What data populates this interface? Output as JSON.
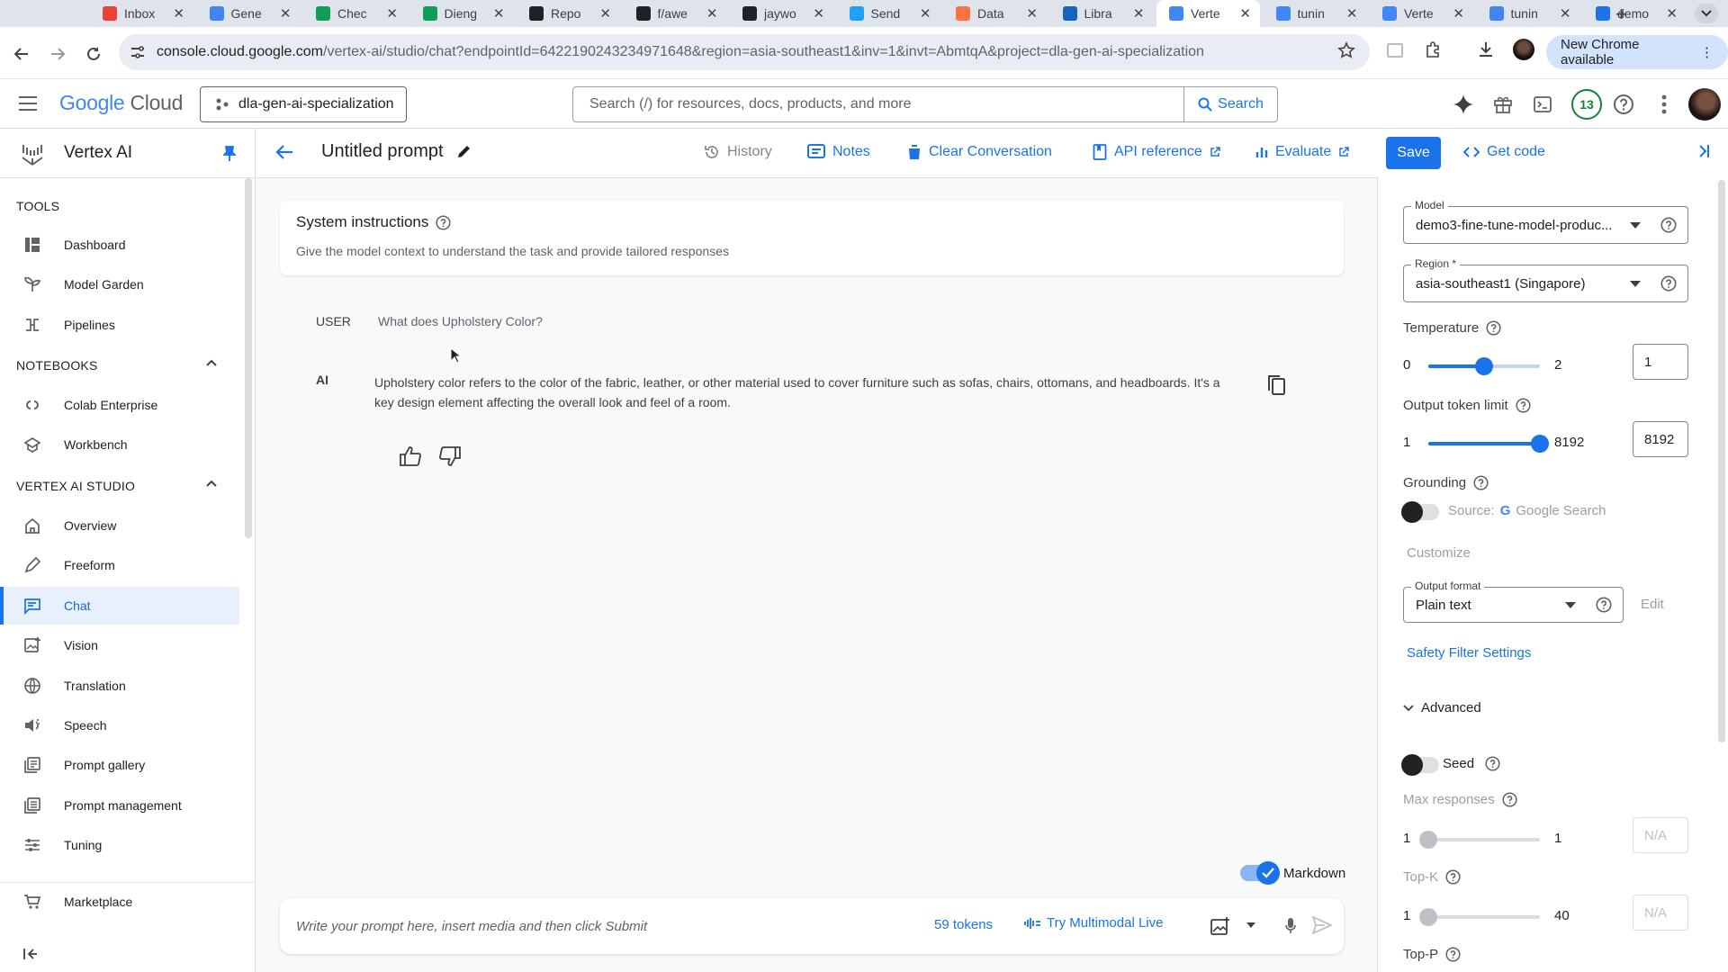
{
  "browser": {
    "tabs": [
      {
        "title": "Inbox",
        "color": "#ea4335"
      },
      {
        "title": "Gene",
        "color": "#4285f4"
      },
      {
        "title": "Chec",
        "color": "#0f9d58"
      },
      {
        "title": "Dieng",
        "color": "#0f9d58"
      },
      {
        "title": "Repo",
        "color": "#202124"
      },
      {
        "title": "f/awe",
        "color": "#202124"
      },
      {
        "title": "jaywo",
        "color": "#202124"
      },
      {
        "title": "Send",
        "color": "#1da1f2"
      },
      {
        "title": "Data",
        "color": "#ff7043"
      },
      {
        "title": "Libra",
        "color": "#1565c0"
      },
      {
        "title": "Verte",
        "color": "#4285f4"
      },
      {
        "title": "tunin",
        "color": "#4285f4"
      },
      {
        "title": "Verte",
        "color": "#4285f4"
      },
      {
        "title": "tunin",
        "color": "#4285f4"
      },
      {
        "title": "demo",
        "color": "#1a73e8"
      }
    ],
    "active_tab_index": 10,
    "url_host": "console.cloud.google.com",
    "url_path": "/vertex-ai/studio/chat?endpointId=6422190243234971648&region=asia-southeast1&inv=1&invt=AbmtqA&project=dla-gen-ai-specialization",
    "update_label": "New Chrome available"
  },
  "gcp": {
    "logo_google": "Google",
    "logo_cloud": "Cloud",
    "project": "dla-gen-ai-specialization",
    "search_placeholder": "Search (/) for resources, docs, products, and more",
    "search_button": "Search",
    "notification_count": "13"
  },
  "sidebar": {
    "title": "Vertex AI",
    "tools_header": "TOOLS",
    "tools": [
      {
        "label": "Dashboard",
        "icon": "dashboard-icon"
      },
      {
        "label": "Model Garden",
        "icon": "model-garden-icon"
      },
      {
        "label": "Pipelines",
        "icon": "pipelines-icon"
      }
    ],
    "notebooks_header": "NOTEBOOKS",
    "notebooks": [
      {
        "label": "Colab Enterprise",
        "icon": "colab-icon"
      },
      {
        "label": "Workbench",
        "icon": "workbench-icon"
      }
    ],
    "studio_header": "VERTEX AI STUDIO",
    "studio": [
      {
        "label": "Overview",
        "icon": "home-icon"
      },
      {
        "label": "Freeform",
        "icon": "freeform-icon"
      },
      {
        "label": "Chat",
        "icon": "chat-icon",
        "active": true
      },
      {
        "label": "Vision",
        "icon": "vision-icon"
      },
      {
        "label": "Translation",
        "icon": "translation-icon"
      },
      {
        "label": "Speech",
        "icon": "speech-icon"
      },
      {
        "label": "Prompt gallery",
        "icon": "prompt-gallery-icon"
      },
      {
        "label": "Prompt management",
        "icon": "prompt-management-icon"
      },
      {
        "label": "Tuning",
        "icon": "tuning-icon"
      }
    ],
    "marketplace": "Marketplace"
  },
  "main": {
    "title": "Untitled prompt",
    "actions": {
      "history": "History",
      "notes": "Notes",
      "clear": "Clear Conversation",
      "api": "API reference",
      "evaluate": "Evaluate"
    },
    "save": "Save",
    "get_code": "Get code",
    "system": {
      "heading": "System instructions",
      "description": "Give the model context to understand the task and provide tailored responses"
    },
    "conversation": {
      "user_role": "USER",
      "user_text": "What does Upholstery Color?",
      "ai_role": "AI",
      "ai_text": "Upholstery color refers to the color of the fabric, leather, or other material used to cover furniture such as sofas, chairs, ottomans, and headboards. It's a key design element affecting the overall look and feel of a room."
    },
    "markdown_label": "Markdown",
    "markdown_on": true,
    "composer_placeholder": "Write your prompt here, insert media and then click Submit",
    "tokens": "59 tokens",
    "try_live": "Try Multimodal Live"
  },
  "panel": {
    "model_label": "Model",
    "model_value": "demo3-fine-tune-model-produc...",
    "region_label": "Region *",
    "region_value": "asia-southeast1 (Singapore)",
    "temperature": {
      "label": "Temperature",
      "min": "0",
      "max": "2",
      "value": "1",
      "fraction": 0.5
    },
    "output_limit": {
      "label": "Output token limit",
      "min": "1",
      "max": "8192",
      "value": "8192",
      "fraction": 1.0
    },
    "grounding": {
      "label": "Grounding",
      "source": "Source:",
      "source_name": "Google Search",
      "customize": "Customize"
    },
    "output_format_label": "Output format",
    "output_format_value": "Plain text",
    "edit": "Edit",
    "safety": "Safety Filter Settings",
    "advanced": "Advanced",
    "seed": "Seed",
    "max_responses": {
      "label": "Max responses",
      "min": "1",
      "max": "1",
      "value": "N/A",
      "fraction": 0.0
    },
    "top_k": {
      "label": "Top-K",
      "min": "1",
      "max": "40",
      "value": "N/A",
      "fraction": 0.0
    },
    "top_p": {
      "label": "Top-P"
    }
  }
}
